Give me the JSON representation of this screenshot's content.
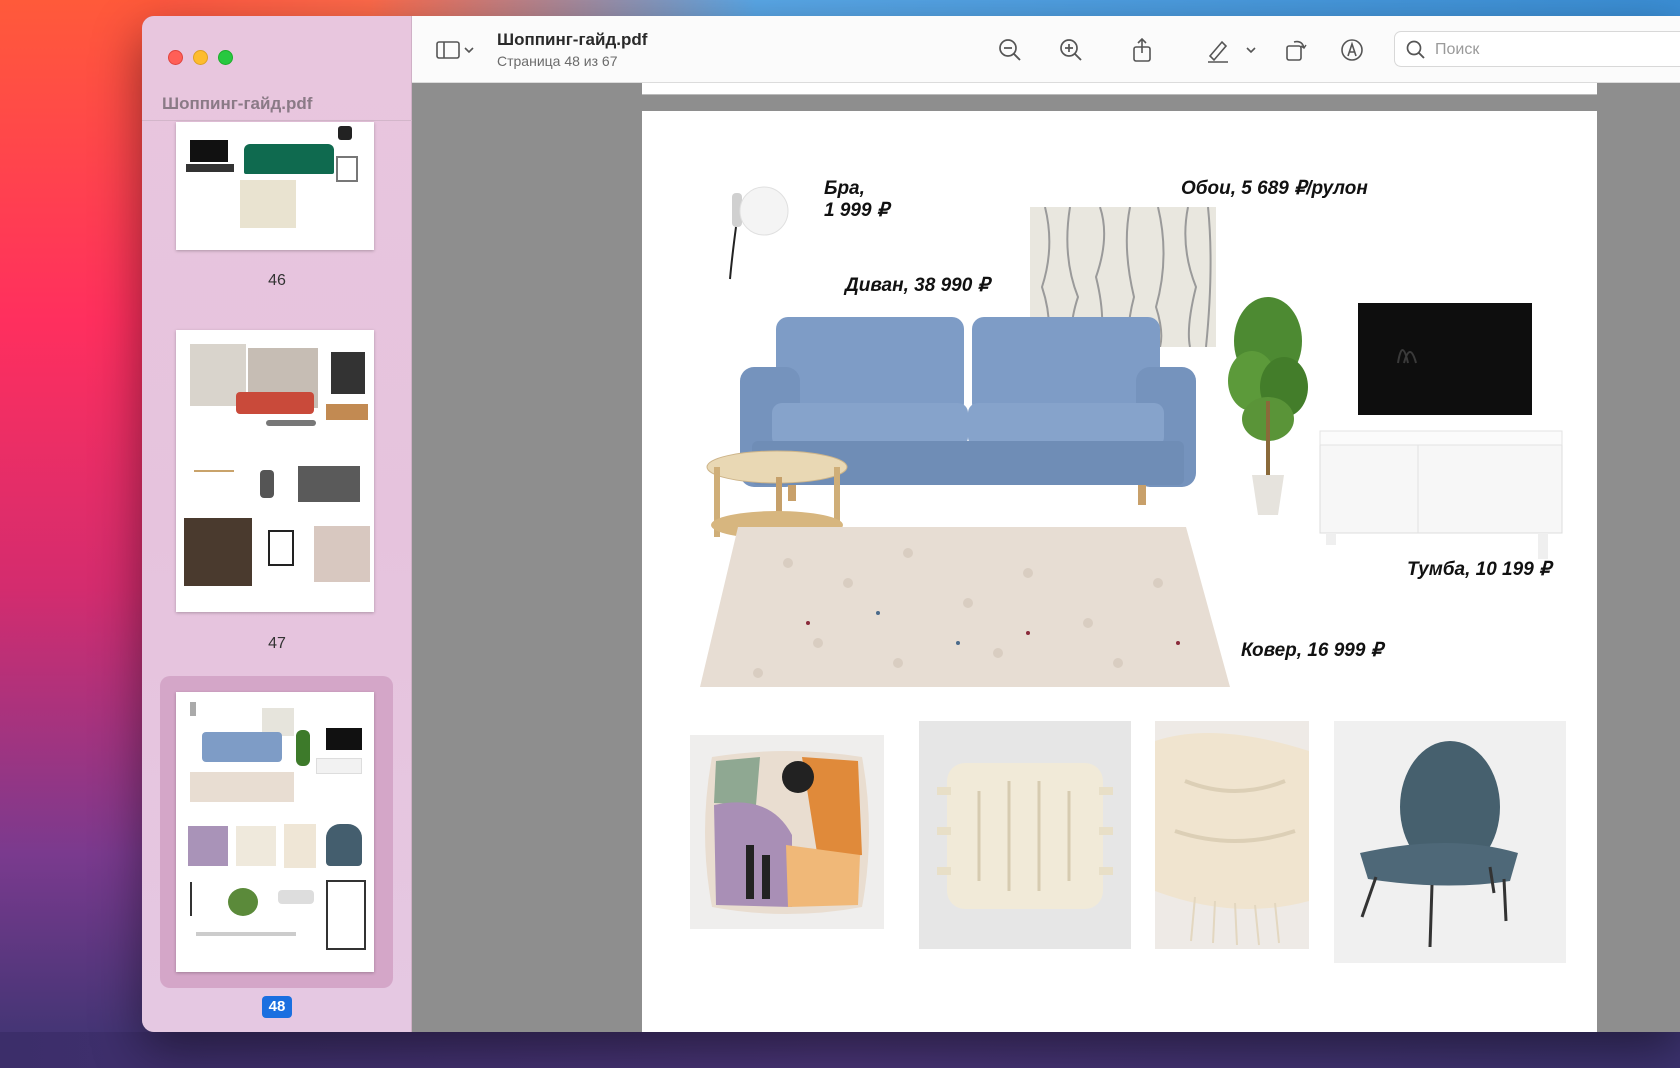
{
  "sidebar": {
    "title": "Шоппинг-гайд.pdf",
    "pages": [
      {
        "number": "46"
      },
      {
        "number": "47"
      },
      {
        "number": "48",
        "selected": true
      }
    ]
  },
  "toolbar": {
    "doc_title": "Шоппинг-гайд.pdf",
    "doc_subtitle": "Страница 48 из 67",
    "search_placeholder": "Поиск",
    "icons": [
      "sidebar-toggle-icon",
      "chevron-down-icon",
      "zoom-out-icon",
      "zoom-in-icon",
      "share-icon",
      "markup-pen-icon",
      "chevron-down-icon",
      "rotate-icon",
      "annotate-icon",
      "search-icon"
    ]
  },
  "page": {
    "captions": {
      "bra": "Бра,\n1 999 ₽",
      "oboi": "Обои, 5 689 ₽/рулон",
      "divan": "Диван, 38 990 ₽",
      "tumba": "Тумба, 10 199 ₽",
      "kover": "Ковер, 16 999 ₽"
    }
  },
  "colors": {
    "accent": "#1a6fe0",
    "sofa": "#7e9cc6",
    "sidebar_bg": "#e8c6de"
  }
}
